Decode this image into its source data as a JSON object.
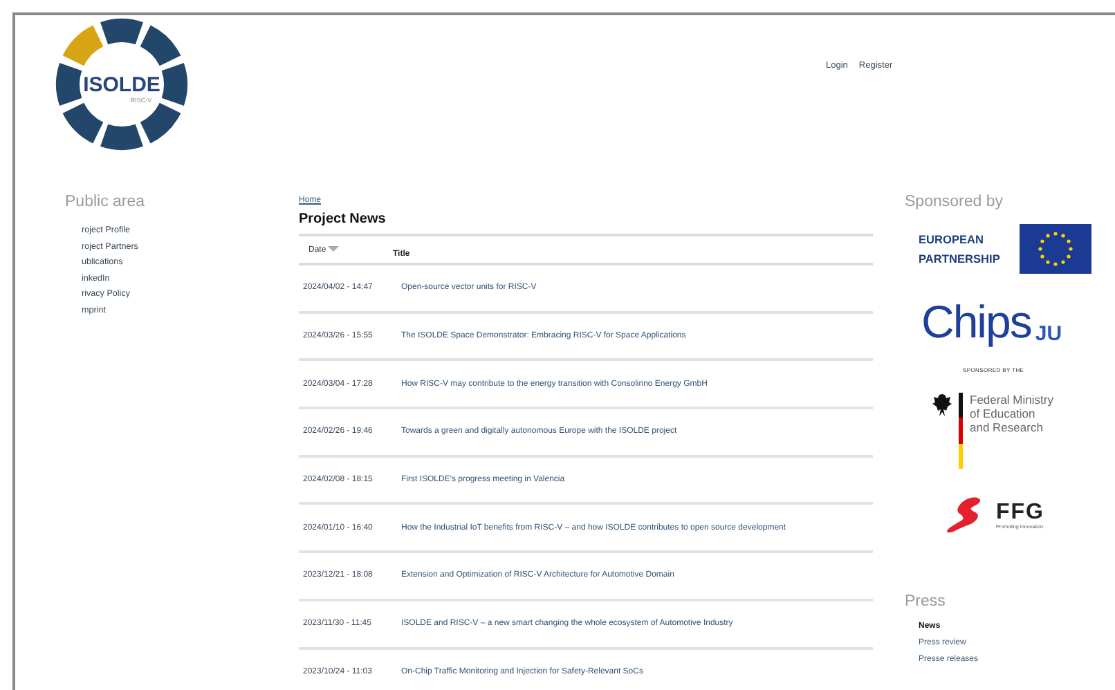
{
  "header": {
    "logo": {
      "title": "ISOLDE",
      "subtitle": "RISC-V"
    },
    "links": [
      "Login",
      "Register"
    ]
  },
  "sidebar": {
    "title": "Public area",
    "items": [
      "roject Profile",
      "roject Partners",
      "ublications",
      "inkedIn",
      "rivacy Policy",
      "mprint"
    ]
  },
  "breadcrumb": "Home",
  "news": {
    "title": "Project News",
    "columns": [
      {
        "label": "Date",
        "sorted": true
      },
      {
        "label": "Title",
        "sorted": false
      }
    ],
    "rows": [
      {
        "date": "2024/04/02 - 14:47",
        "title": "Open-source vector units for RISC-V"
      },
      {
        "date": "2024/03/26 - 15:55",
        "title": "The ISOLDE Space Demonstrator: Embracing RISC-V for Space Applications"
      },
      {
        "date": "2024/03/04 - 17:28",
        "title": "How RISC-V may contribute to the energy transition with Consolinno Energy GmbH"
      },
      {
        "date": "2024/02/26 - 19:46",
        "title": "Towards a green and digitally autonomous Europe with the ISOLDE project"
      },
      {
        "date": "2024/02/08 - 18:15",
        "title": "First ISOLDE's progress meeting in Valencia"
      },
      {
        "date": "2024/01/10 - 16:40",
        "title": "How the Industrial IoT benefits from RISC-V – and how ISOLDE contributes to open source development"
      },
      {
        "date": "2023/12/21 - 18:08",
        "title": "Extension and Optimization of RISC-V Architecture for Automotive Domain"
      },
      {
        "date": "2023/11/30 - 11:45",
        "title": "ISOLDE and RISC-V – a new smart changing the whole ecosystem of Automotive Industry"
      },
      {
        "date": "2023/10/24 - 11:03",
        "title": "On-Chip Traffic Monitoring and Injection for Safety-Relevant SoCs"
      }
    ]
  },
  "sponsors": {
    "title": "Sponsored by",
    "european_partnership": [
      "EUROPEAN",
      "PARTNERSHIP"
    ],
    "chips_ju": {
      "name": "Chips",
      "suffix": "JU"
    },
    "ministry": {
      "caption": "SPONSORED BY THE",
      "lines": [
        "Federal Ministry",
        "of Education",
        "and Research"
      ]
    },
    "ffg": {
      "name": "FFG",
      "tagline": "Promoting Innovation."
    }
  },
  "press": {
    "title": "Press",
    "items": [
      {
        "label": "News",
        "selected": true
      },
      {
        "label": "Press review",
        "selected": false
      },
      {
        "label": "Presse releases",
        "selected": false
      }
    ]
  }
}
